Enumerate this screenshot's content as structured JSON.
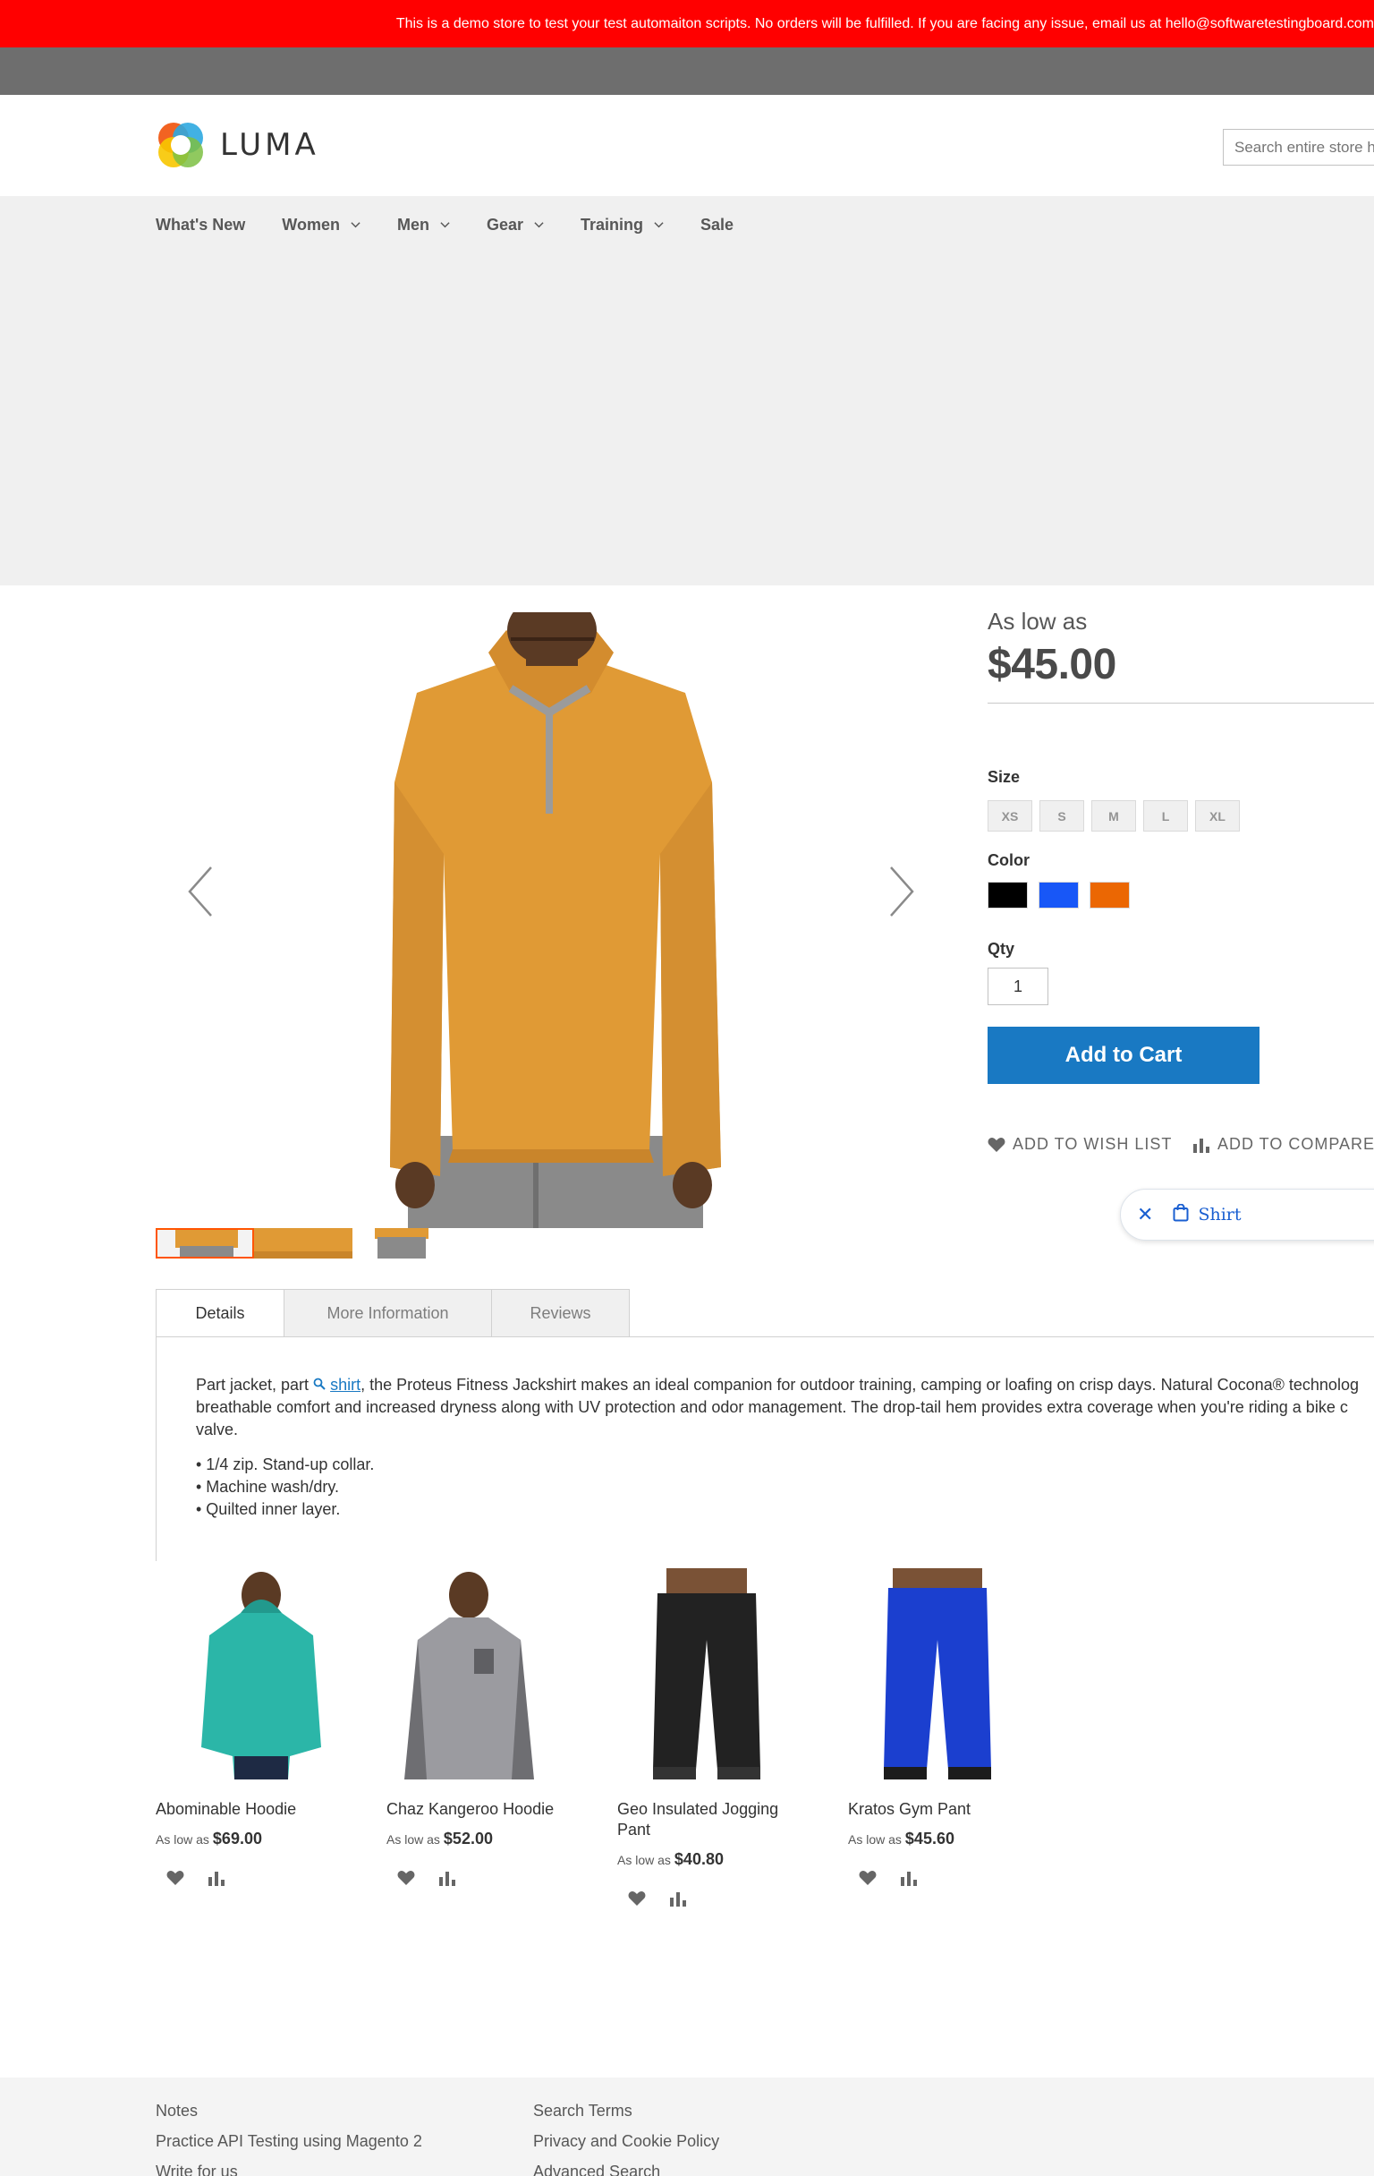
{
  "banner": {
    "text": "This is a demo store to test your test automaiton scripts. No orders will be fulfilled. If you are facing any issue, email us at hello@softwaretestingboard.com"
  },
  "header": {
    "logo_text": "LUMA",
    "search_placeholder": "Search entire store here..."
  },
  "nav": [
    {
      "label": "What's New",
      "has_dropdown": false
    },
    {
      "label": "Women",
      "has_dropdown": true
    },
    {
      "label": "Men",
      "has_dropdown": true
    },
    {
      "label": "Gear",
      "has_dropdown": true
    },
    {
      "label": "Training",
      "has_dropdown": true
    },
    {
      "label": "Sale",
      "has_dropdown": false
    }
  ],
  "product": {
    "price_prefix": "As low as",
    "price": "$45.00",
    "size_label": "Size",
    "sizes": [
      "XS",
      "S",
      "M",
      "L",
      "XL"
    ],
    "color_label": "Color",
    "colors": [
      "#000000",
      "#1857f7",
      "#eb6703"
    ],
    "qty_label": "Qty",
    "qty_value": "1",
    "add_to_cart": "Add to Cart",
    "wish_list": "ADD TO WISH LIST",
    "compare": "ADD TO COMPARE"
  },
  "chip": {
    "label": "Shirt"
  },
  "tabs": [
    "Details",
    "More Information",
    "Reviews"
  ],
  "details": {
    "line1_a": "Part jacket, part",
    "line1_link": "shirt",
    "line1_b": ", the Proteus Fitness Jackshirt makes an ideal companion for outdoor training, camping or loafing on crisp days. Natural Cocona® technolog",
    "line2": "breathable comfort and increased dryness along with UV protection and odor management. The drop-tail hem provides extra coverage when you're riding a bike c",
    "line3": "valve.",
    "bullets": [
      "• 1/4 zip. Stand-up collar.",
      "• Machine wash/dry.",
      "• Quilted inner layer."
    ]
  },
  "related": [
    {
      "name": "Abominable Hoodie",
      "price_prefix": "As low as",
      "price": "$69.00"
    },
    {
      "name": "Chaz Kangeroo Hoodie",
      "price_prefix": "As low as",
      "price": "$52.00"
    },
    {
      "name": "Geo Insulated Jogging Pant",
      "price_prefix": "As low as",
      "price": "$40.80"
    },
    {
      "name": "Kratos Gym Pant",
      "price_prefix": "As low as",
      "price": "$45.60"
    }
  ],
  "footer": {
    "col1": [
      "Notes",
      "Practice API Testing using Magento 2",
      "Write for us"
    ],
    "col2": [
      "Search Terms",
      "Privacy and Cookie Policy",
      "Advanced Search"
    ]
  },
  "colors": {
    "banner": "#ff0000",
    "primary": "#1979c3",
    "product_shirt": "#e09a35"
  }
}
